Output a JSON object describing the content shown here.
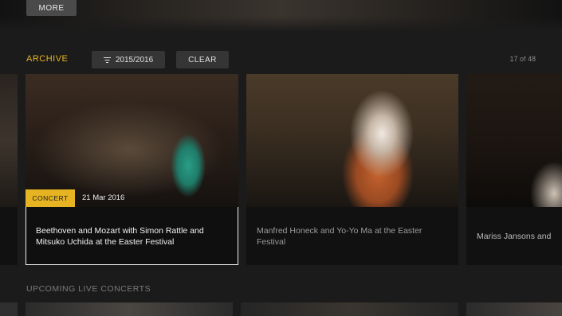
{
  "hero": {
    "more_label": "MORE"
  },
  "archive": {
    "title": "ARCHIVE",
    "filter_label": "2015/2016",
    "clear_label": "CLEAR",
    "counter": "17 of 48"
  },
  "cards": [
    {
      "badge": "CONCERT",
      "date": "21 Mar 2016",
      "title": "Beethoven and Mozart with Simon Rattle and Mitsuko Uchida at the Easter Festival"
    },
    {
      "title": "Manfred Honeck and Yo-Yo Ma at the Easter Festival"
    },
    {
      "title": "Mariss Jansons and"
    }
  ],
  "upcoming": {
    "title": "UPCOMING LIVE CONCERTS"
  },
  "colors": {
    "accent": "#e6b422",
    "background": "#1b1b1b"
  },
  "icons": {
    "filter": "filter-lines-icon"
  }
}
